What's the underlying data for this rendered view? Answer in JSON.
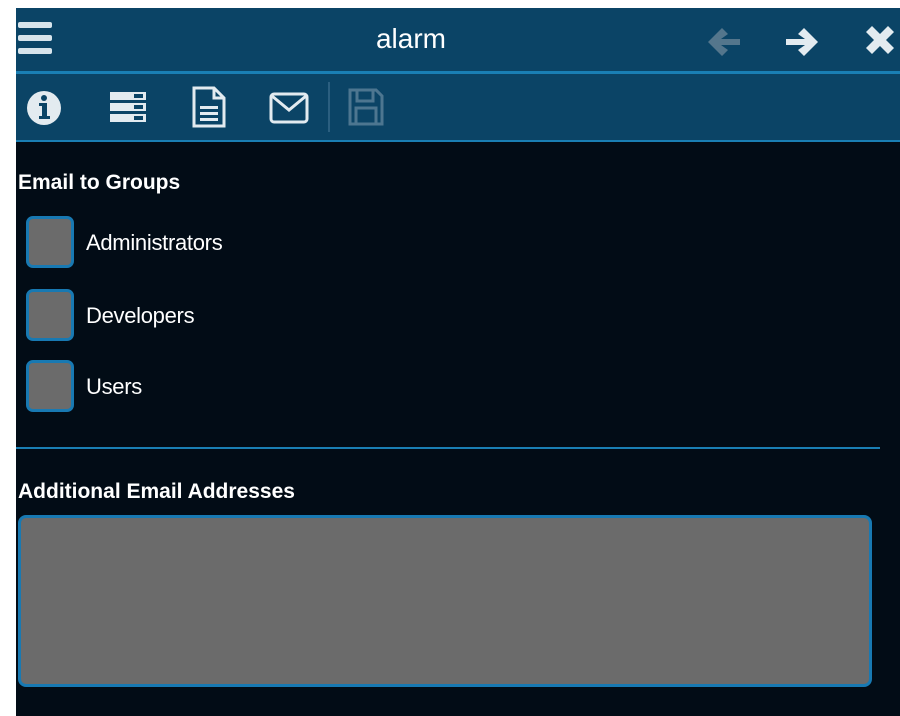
{
  "window": {
    "title": "alarm"
  },
  "toolbar": {
    "icons": [
      "info-icon",
      "list-icon",
      "document-icon",
      "envelope-icon",
      "save-icon"
    ]
  },
  "email_groups": {
    "heading": "Email to Groups",
    "groups": [
      {
        "label": "Administrators",
        "checked": false
      },
      {
        "label": "Developers",
        "checked": false
      },
      {
        "label": "Users",
        "checked": false
      }
    ]
  },
  "additional": {
    "heading": "Additional Email Addresses",
    "value": ""
  },
  "colors": {
    "header_bg": "#0b4466",
    "accent": "#1a7fb4",
    "content_bg": "#020c16",
    "field_bg": "#6b6b6b"
  }
}
